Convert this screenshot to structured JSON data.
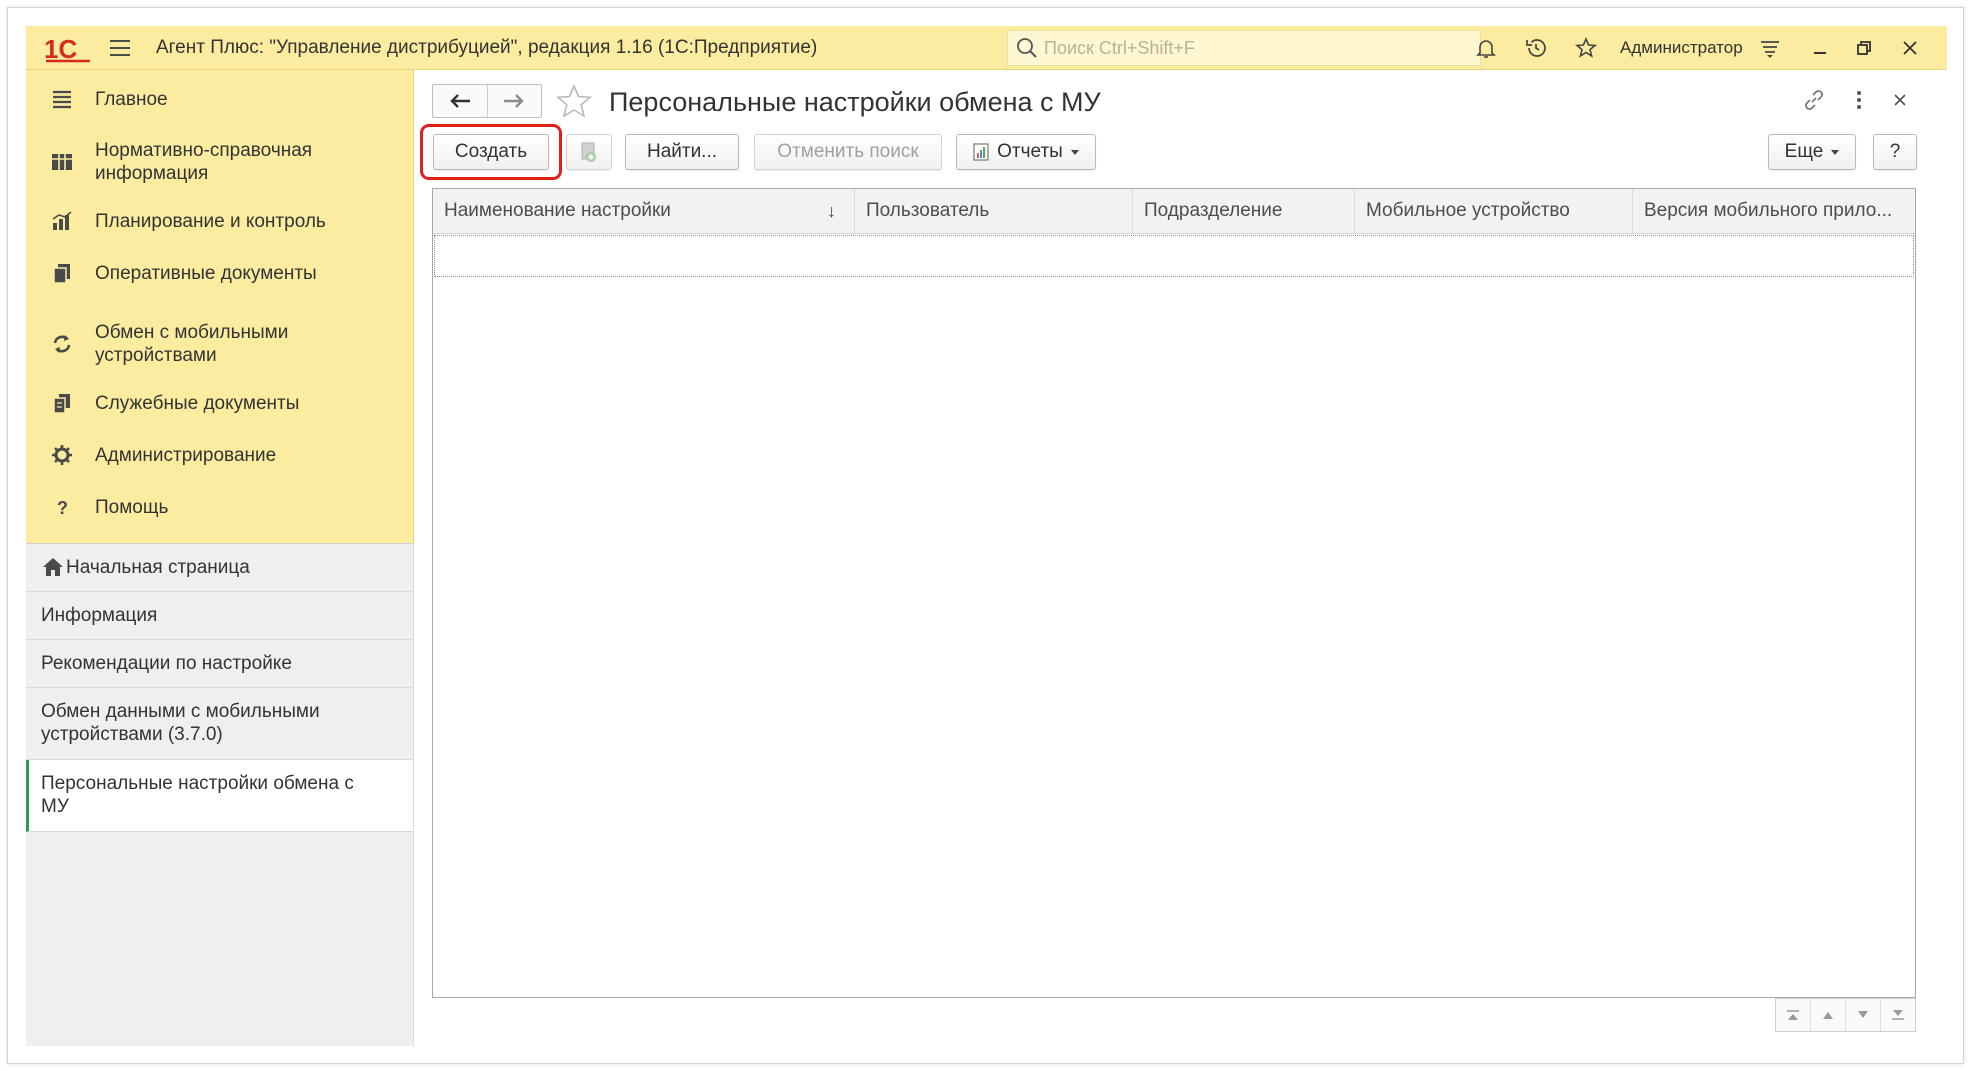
{
  "window": {
    "title": "Агент Плюс: \"Управление дистрибуцией\", редакция 1.16  (1С:Предприятие)",
    "search_placeholder": "Поиск Ctrl+Shift+F",
    "user": "Администратор"
  },
  "sidebar": {
    "items": [
      {
        "label": "Главное",
        "icon": "menu-lines-icon"
      },
      {
        "label": "Нормативно-справочная информация",
        "icon": "grid-table-icon"
      },
      {
        "label": "Планирование и контроль",
        "icon": "bar-chart-icon"
      },
      {
        "label": "Оперативные документы",
        "icon": "documents-icon"
      },
      {
        "label": "Обмен с мобильными устройствами",
        "icon": "sync-icon"
      },
      {
        "label": "Служебные документы",
        "icon": "service-docs-icon"
      },
      {
        "label": "Администрирование",
        "icon": "gear-icon"
      },
      {
        "label": "Помощь",
        "icon": "question-icon"
      }
    ]
  },
  "recent": {
    "items": [
      {
        "label": "Начальная страница"
      },
      {
        "label": "Информация"
      },
      {
        "label": "Рекомендации по настройке"
      },
      {
        "label": "Обмен данными с мобильными устройствами (3.7.0)"
      },
      {
        "label": "Персональные настройки обмена с МУ"
      }
    ]
  },
  "form": {
    "title": "Персональные настройки обмена с МУ",
    "buttons": {
      "create": "Создать",
      "find": "Найти...",
      "cancel_search": "Отменить поиск",
      "reports": "Отчеты",
      "more": "Еще",
      "help": "?"
    },
    "columns": [
      {
        "label": "Наименование настройки",
        "sort": "↓"
      },
      {
        "label": "Пользователь"
      },
      {
        "label": "Подразделение"
      },
      {
        "label": "Мобильное устройство"
      },
      {
        "label": "Версия мобильного прило..."
      }
    ]
  },
  "colors": {
    "panel_yellow": "#fbeca0",
    "highlight_red": "#e0201b",
    "active_green": "#2e9a57",
    "logo_red": "#d52b1e"
  }
}
